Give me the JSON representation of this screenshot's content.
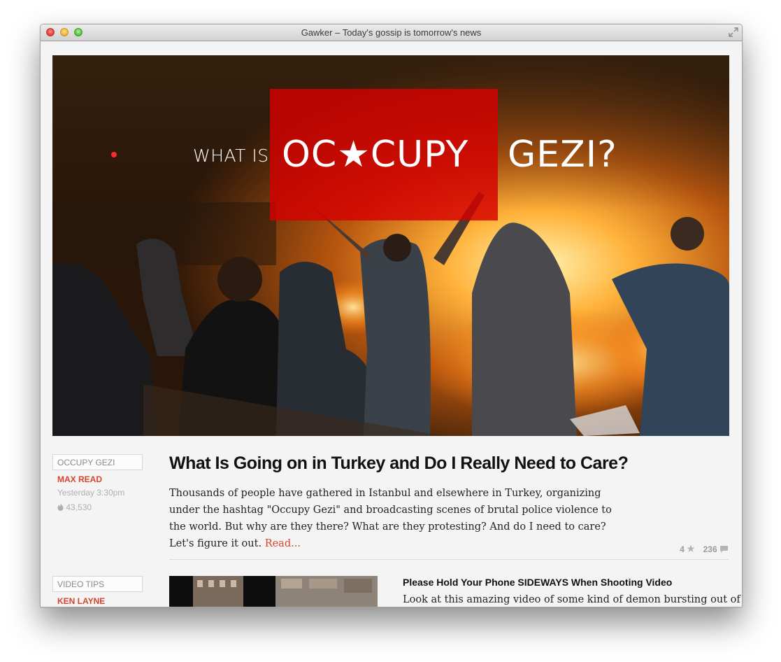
{
  "window": {
    "title": "Gawker – Today's gossip is tomorrow's news"
  },
  "hero": {
    "what_is": "WHAT IS",
    "occupy": "OC★CUPY",
    "gezi": "GEZI?",
    "accent_color": "#d60000"
  },
  "articles": [
    {
      "tag": "OCCUPY GEZI",
      "author": "MAX READ",
      "timestamp": "Yesterday 3:30pm",
      "views": "43,530",
      "headline": "What Is Going on in Turkey and Do I Really Need to Care?",
      "excerpt": "Thousands of people have gathered in Istanbul and elsewhere in Turkey, organizing under the hashtag \"Occupy Gezi\" and broadcasting scenes of brutal police violence to the world. But why are they there? What are they protesting? And do I need to care? Let's figure it out.",
      "read_more": "Read...",
      "likes": "4",
      "comments": "236"
    },
    {
      "tag": "VIDEO TIPS",
      "author": "KEN LAYNE",
      "headline": "Please Hold Your Phone SIDEWAYS When Shooting Video",
      "excerpt": "Look at this amazing video of some kind of demon bursting out of a"
    }
  ],
  "icons": {
    "flame": "flame-icon",
    "star": "star-icon",
    "comment": "comment-bubble-icon",
    "fullscreen": "fullscreen-icon"
  },
  "colors": {
    "link_red": "#d9432e",
    "background": "#f4f4f4"
  }
}
